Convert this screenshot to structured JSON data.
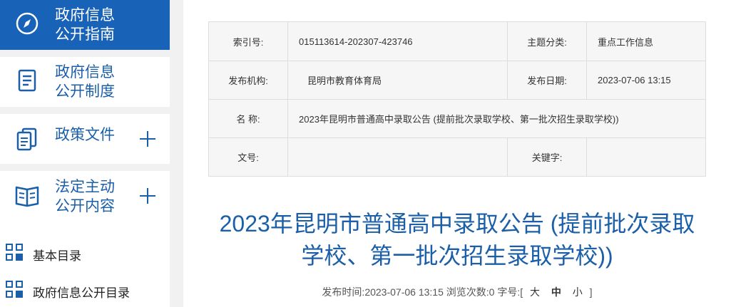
{
  "sidebar": {
    "nav": [
      {
        "line1": "政府信息",
        "line2": "公开指南",
        "icon": "compass-icon",
        "active": true
      },
      {
        "line1": "政府信息",
        "line2": "公开制度",
        "icon": "document-icon"
      },
      {
        "line1": "政策文件",
        "line2": "",
        "icon": "files-icon",
        "expandable": true
      },
      {
        "line1": "法定主动",
        "line2": "公开内容",
        "icon": "book-icon",
        "expandable": true
      }
    ],
    "subitems": [
      {
        "label": "基本目录",
        "icon": "grid-icon"
      },
      {
        "label": "政府信息公开目录",
        "icon": "grid-icon"
      }
    ]
  },
  "meta": {
    "index_label": "索引号:",
    "index_value": "015113614-202307-423746",
    "category_label": "主题分类:",
    "category_value": "重点工作信息",
    "publisher_label": "发布机构:",
    "publisher_value": "昆明市教育体育局",
    "date_label": "发布日期:",
    "date_value": "2023-07-06 13:15",
    "name_label": "名 称:",
    "name_value": "2023年昆明市普通高中录取公告 (提前批次录取学校、第一批次招生录取学校))",
    "docno_label": "文号:",
    "docno_value": "",
    "keywords_label": "关键字:",
    "keywords_value": ""
  },
  "article": {
    "title_line1": "2023年昆明市普通高中录取公告 (提前批次录取",
    "title_line2": "学校、第一批次招生录取学校))",
    "publish_label": "发布时间:",
    "publish_time": "2023-07-06 13:15",
    "views_label": "浏览次数:",
    "views": "0",
    "fontsize_label": "字号:",
    "bracket_open": "[",
    "size_large": "大",
    "size_medium": "中",
    "size_small": "小",
    "bracket_close": "]"
  },
  "colors": {
    "accent": "#1862b8",
    "text_blue": "#1a5fa8"
  }
}
